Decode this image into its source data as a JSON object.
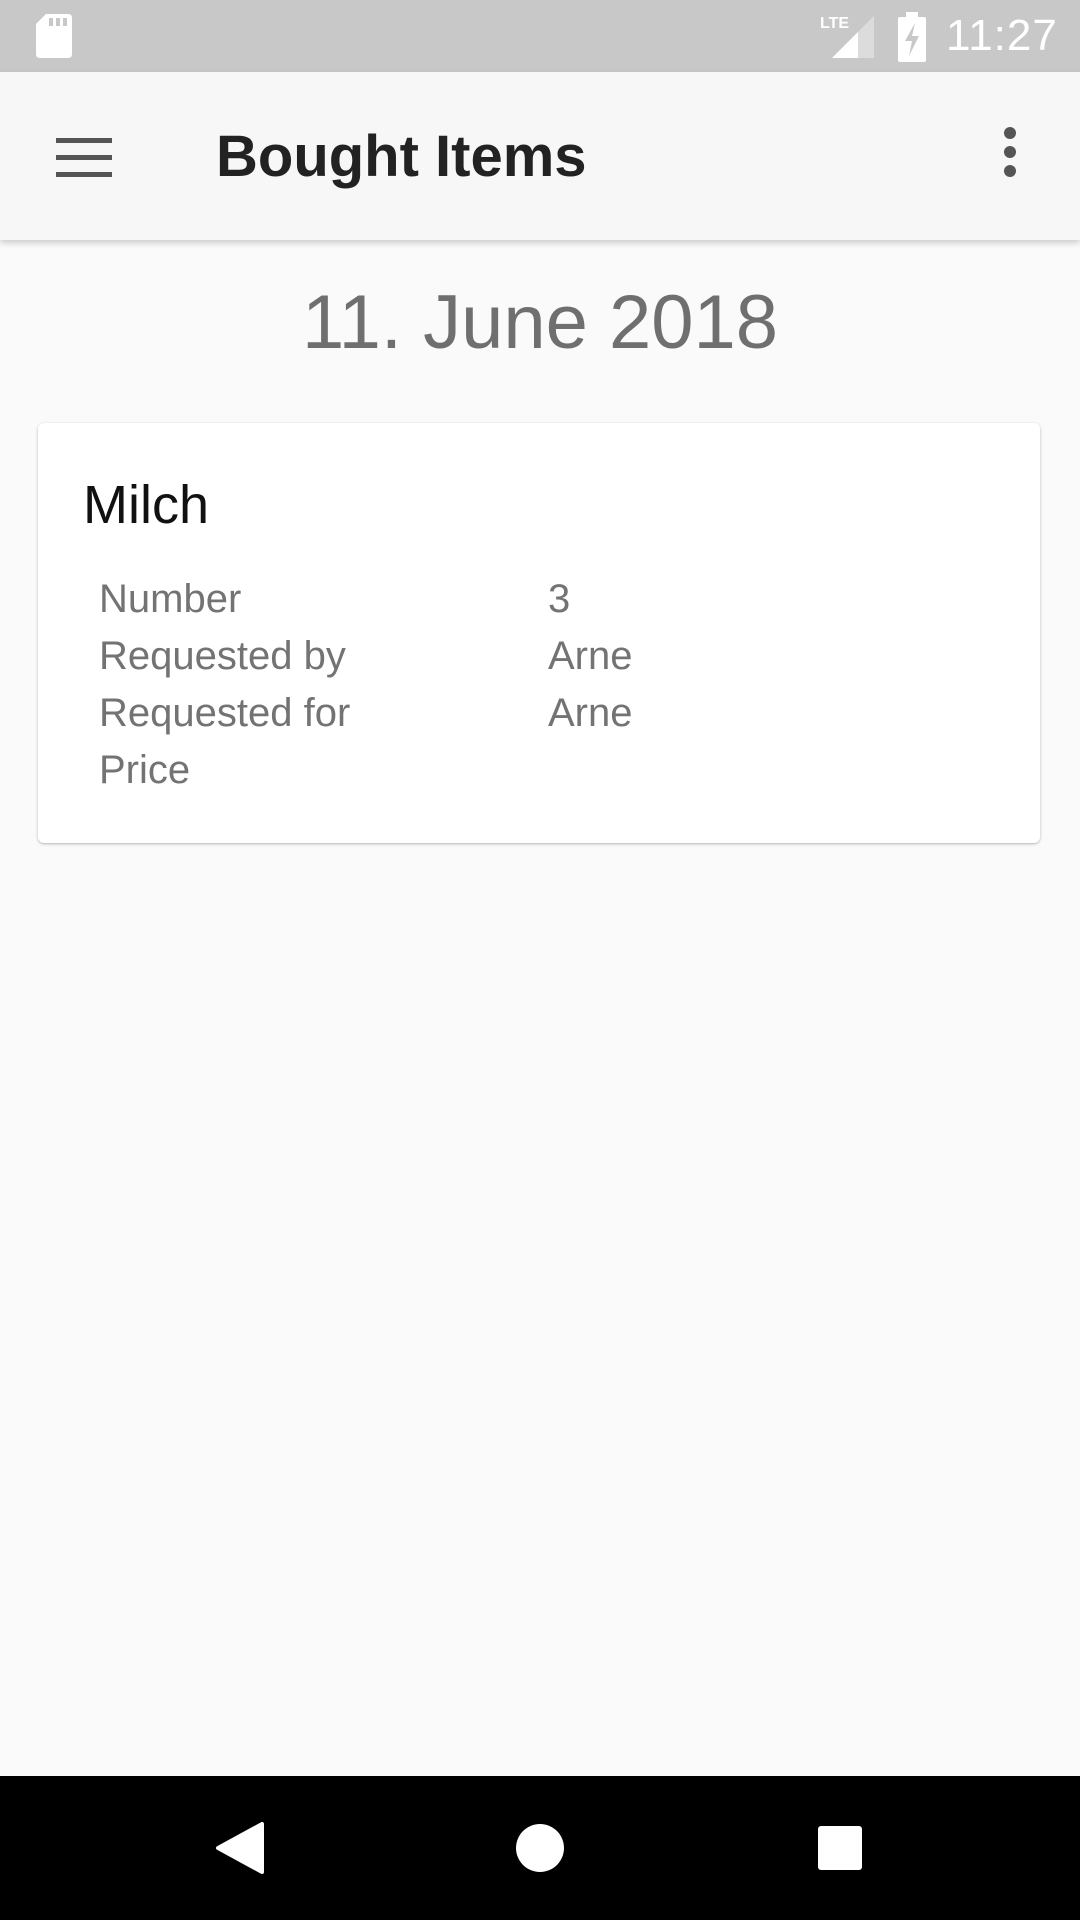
{
  "status_bar": {
    "time": "11:27",
    "network": "LTE",
    "icons": [
      "sd-card-icon",
      "lte-signal-icon",
      "battery-charging-icon"
    ]
  },
  "app_bar": {
    "title": "Bought Items",
    "icons": [
      "menu-icon",
      "overflow-menu-icon"
    ]
  },
  "date_header": "11. June 2018",
  "item": {
    "name": "Milch",
    "details": [
      {
        "label": "Number",
        "value": "3"
      },
      {
        "label": "Requested by",
        "value": "Arne"
      },
      {
        "label": "Requested for",
        "value": "Arne"
      },
      {
        "label": "Price",
        "value": ""
      }
    ]
  },
  "nav_bar": {
    "icons": [
      "back-icon",
      "home-icon",
      "recents-icon"
    ]
  },
  "colors": {
    "status_bar": "#c8c8c8",
    "app_bar": "#f7f7f7",
    "background": "#fafafa",
    "nav_bar": "#000000"
  }
}
